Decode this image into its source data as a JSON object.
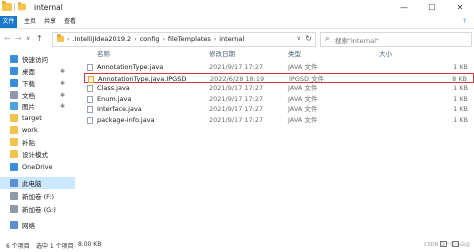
{
  "window": {
    "title": "internal",
    "minimize": "—",
    "maximize": "☐",
    "close": "✕"
  },
  "ribbon": {
    "file": "文件",
    "tabs": [
      "主页",
      "共享",
      "查看"
    ],
    "help": "?"
  },
  "nav": {
    "back": "←",
    "forward": "→",
    "up_dropdown": "∨",
    "up": "↑",
    "breadcrumbs": [
      ".IntelliJIdea2019.2",
      "config",
      "fileTemplates",
      "internal"
    ],
    "dropdown": "∨",
    "refresh": "↻",
    "search_placeholder": "搜索\"internal\""
  },
  "sidebar": {
    "items": [
      {
        "label": "快速访问",
        "color": "#3a8fd9",
        "pinned": false
      },
      {
        "label": "桌面",
        "color": "#3a8fd9",
        "pinned": true
      },
      {
        "label": "下载",
        "color": "#3a8fd9",
        "pinned": true
      },
      {
        "label": "文档",
        "color": "#8d9aa8",
        "pinned": true
      },
      {
        "label": "图片",
        "color": "#4aa3df",
        "pinned": true
      },
      {
        "label": "target",
        "color": "#f3c54e",
        "pinned": false
      },
      {
        "label": "work",
        "color": "#f3c54e",
        "pinned": false
      },
      {
        "label": "补贴",
        "color": "#f3c54e",
        "pinned": false
      },
      {
        "label": "设计模式",
        "color": "#f3c54e",
        "pinned": false
      },
      {
        "label": "OneDrive",
        "color": "#3a8fd9",
        "pinned": false
      },
      {
        "label": "此电脑",
        "color": "#5a8fd0",
        "pinned": false
      },
      {
        "label": "新加卷 (F:)",
        "color": "#8d9aa8",
        "pinned": false
      },
      {
        "label": "新加卷 (G:)",
        "color": "#8d9aa8",
        "pinned": false
      },
      {
        "label": "网络",
        "color": "#5a8fd0",
        "pinned": false
      }
    ],
    "pin_glyph": "✱"
  },
  "columns": {
    "name": "名称",
    "date": "修改日期",
    "type": "类型",
    "size": "大小"
  },
  "files": [
    {
      "name": "AnnotationType.java",
      "date": "2021/9/17 17:27",
      "type": "JAVA 文件",
      "size": "1 KB",
      "locked": false
    },
    {
      "name": "AnnotationType.java.IPGSD",
      "date": "2022/6/28 18:19",
      "type": "IPGSD 文件",
      "size": "8 KB",
      "locked": true
    },
    {
      "name": "Class.java",
      "date": "2021/9/17 17:27",
      "type": "JAVA 文件",
      "size": "1 KB",
      "locked": false
    },
    {
      "name": "Enum.java",
      "date": "2021/9/17 17:27",
      "type": "JAVA 文件",
      "size": "1 KB",
      "locked": false
    },
    {
      "name": "Interface.java",
      "date": "2021/9/17 17:27",
      "type": "JAVA 文件",
      "size": "1 KB",
      "locked": false
    },
    {
      "name": "package-info.java",
      "date": "2021/9/17 17:27",
      "type": "JAVA 文件",
      "size": "1 KB",
      "locked": false
    }
  ],
  "status": {
    "count": "6 个项目",
    "selected": "选中 1 个项目",
    "size": "8.00 KB",
    "watermark": "CSDN @一只小白@"
  }
}
